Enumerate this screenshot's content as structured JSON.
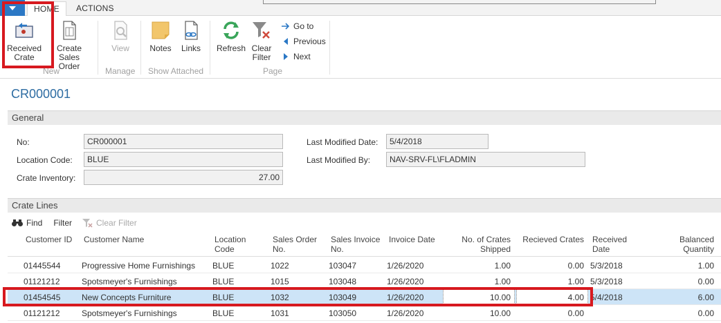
{
  "tabs": [
    "HOME",
    "ACTIONS"
  ],
  "ribbon": {
    "buttons": {
      "received_crate": [
        "Received",
        "Crate"
      ],
      "create_sales_order": [
        "Create Sales",
        "Order"
      ],
      "view": "View",
      "notes": "Notes",
      "links": "Links",
      "refresh": "Refresh",
      "clear_filter": [
        "Clear",
        "Filter"
      ]
    },
    "nav": [
      "Go to",
      "Previous",
      "Next"
    ],
    "groups": [
      "New",
      "Manage",
      "Show Attached",
      "Page"
    ]
  },
  "page_title": "CR000001",
  "general": {
    "header": "General",
    "no_label": "No:",
    "no_value": "CR000001",
    "location_label": "Location Code:",
    "location_value": "BLUE",
    "inventory_label": "Crate Inventory:",
    "inventory_value": "27.00",
    "modified_date_label": "Last Modified Date:",
    "modified_date_value": "5/4/2018",
    "modified_by_label": "Last Modified By:",
    "modified_by_value": "NAV-SRV-FL\\FLADMIN"
  },
  "lines": {
    "header": "Crate Lines",
    "toolbar": [
      "Find",
      "Filter",
      "Clear Filter"
    ],
    "columns": [
      [
        "Customer ID"
      ],
      [
        "Customer Name"
      ],
      [
        "Location",
        "Code"
      ],
      [
        "Sales Order",
        "No."
      ],
      [
        "Sales Invoice",
        "No."
      ],
      [
        "Invoice Date"
      ],
      [
        "No. of Crates",
        "Shipped"
      ],
      [
        "Recieved Crates"
      ],
      [
        "Received",
        "Date"
      ],
      [
        "Balanced",
        "Quantity"
      ]
    ],
    "rows": [
      [
        "01445544",
        "Progressive Home Furnishings",
        "BLUE",
        "1022",
        "103047",
        "1/26/2020",
        "1.00",
        "0.00",
        "5/3/2018",
        "1.00"
      ],
      [
        "01121212",
        "Spotsmeyer's Furnishings",
        "BLUE",
        "1015",
        "103048",
        "1/26/2020",
        "1.00",
        "1.00",
        "5/3/2018",
        "0.00"
      ],
      [
        "01454545",
        "New Concepts Furniture",
        "BLUE",
        "1032",
        "103049",
        "1/26/2020",
        "10.00",
        "4.00",
        "5/4/2018",
        "6.00"
      ],
      [
        "01121212",
        "Spotsmeyer's Furnishings",
        "BLUE",
        "1031",
        "103050",
        "1/26/2020",
        "10.00",
        "0.00",
        "",
        "0.00"
      ]
    ]
  },
  "colors": {
    "accent": "#2b78c5",
    "title": "#2d6ca2",
    "highlight": "#d7191f",
    "selected_row": "#cde4f7"
  }
}
